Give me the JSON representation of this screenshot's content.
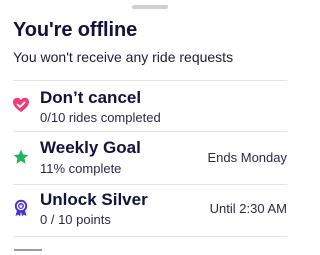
{
  "header": {
    "title": "You're offline",
    "subtitle": "You won't receive any ride requests"
  },
  "items": [
    {
      "icon": "heart-check-icon",
      "title": "Don’t cancel",
      "subtitle": "0/10 rides completed",
      "right": "",
      "icon_color": "#ee3d7a"
    },
    {
      "icon": "star-icon",
      "title": "Weekly Goal",
      "subtitle": "11% complete",
      "right": "Ends Monday",
      "icon_color": "#22b35e"
    },
    {
      "icon": "medal-icon",
      "title": "Unlock Silver",
      "subtitle": "0 / 10 points",
      "right": "Until 2:30 AM",
      "icon_color": "#4b2fd0"
    }
  ],
  "colors": {
    "text_primary": "#12123a",
    "divider": "#e3e3ea",
    "handle": "#cfcfd6"
  }
}
